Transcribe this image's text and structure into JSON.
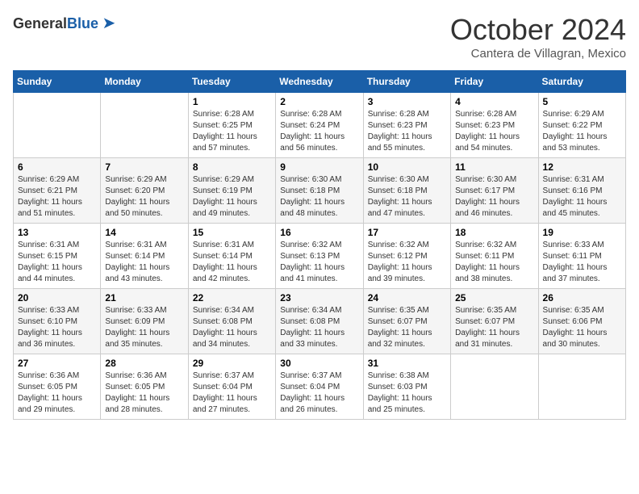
{
  "logo": {
    "general": "General",
    "blue": "Blue"
  },
  "title": "October 2024",
  "location": "Cantera de Villagran, Mexico",
  "weekdays": [
    "Sunday",
    "Monday",
    "Tuesday",
    "Wednesday",
    "Thursday",
    "Friday",
    "Saturday"
  ],
  "weeks": [
    [
      null,
      null,
      {
        "day": 1,
        "sunrise": "6:28 AM",
        "sunset": "6:25 PM",
        "daylight": "11 hours and 57 minutes."
      },
      {
        "day": 2,
        "sunrise": "6:28 AM",
        "sunset": "6:24 PM",
        "daylight": "11 hours and 56 minutes."
      },
      {
        "day": 3,
        "sunrise": "6:28 AM",
        "sunset": "6:23 PM",
        "daylight": "11 hours and 55 minutes."
      },
      {
        "day": 4,
        "sunrise": "6:28 AM",
        "sunset": "6:23 PM",
        "daylight": "11 hours and 54 minutes."
      },
      {
        "day": 5,
        "sunrise": "6:29 AM",
        "sunset": "6:22 PM",
        "daylight": "11 hours and 53 minutes."
      }
    ],
    [
      {
        "day": 6,
        "sunrise": "6:29 AM",
        "sunset": "6:21 PM",
        "daylight": "11 hours and 51 minutes."
      },
      {
        "day": 7,
        "sunrise": "6:29 AM",
        "sunset": "6:20 PM",
        "daylight": "11 hours and 50 minutes."
      },
      {
        "day": 8,
        "sunrise": "6:29 AM",
        "sunset": "6:19 PM",
        "daylight": "11 hours and 49 minutes."
      },
      {
        "day": 9,
        "sunrise": "6:30 AM",
        "sunset": "6:18 PM",
        "daylight": "11 hours and 48 minutes."
      },
      {
        "day": 10,
        "sunrise": "6:30 AM",
        "sunset": "6:18 PM",
        "daylight": "11 hours and 47 minutes."
      },
      {
        "day": 11,
        "sunrise": "6:30 AM",
        "sunset": "6:17 PM",
        "daylight": "11 hours and 46 minutes."
      },
      {
        "day": 12,
        "sunrise": "6:31 AM",
        "sunset": "6:16 PM",
        "daylight": "11 hours and 45 minutes."
      }
    ],
    [
      {
        "day": 13,
        "sunrise": "6:31 AM",
        "sunset": "6:15 PM",
        "daylight": "11 hours and 44 minutes."
      },
      {
        "day": 14,
        "sunrise": "6:31 AM",
        "sunset": "6:14 PM",
        "daylight": "11 hours and 43 minutes."
      },
      {
        "day": 15,
        "sunrise": "6:31 AM",
        "sunset": "6:14 PM",
        "daylight": "11 hours and 42 minutes."
      },
      {
        "day": 16,
        "sunrise": "6:32 AM",
        "sunset": "6:13 PM",
        "daylight": "11 hours and 41 minutes."
      },
      {
        "day": 17,
        "sunrise": "6:32 AM",
        "sunset": "6:12 PM",
        "daylight": "11 hours and 39 minutes."
      },
      {
        "day": 18,
        "sunrise": "6:32 AM",
        "sunset": "6:11 PM",
        "daylight": "11 hours and 38 minutes."
      },
      {
        "day": 19,
        "sunrise": "6:33 AM",
        "sunset": "6:11 PM",
        "daylight": "11 hours and 37 minutes."
      }
    ],
    [
      {
        "day": 20,
        "sunrise": "6:33 AM",
        "sunset": "6:10 PM",
        "daylight": "11 hours and 36 minutes."
      },
      {
        "day": 21,
        "sunrise": "6:33 AM",
        "sunset": "6:09 PM",
        "daylight": "11 hours and 35 minutes."
      },
      {
        "day": 22,
        "sunrise": "6:34 AM",
        "sunset": "6:08 PM",
        "daylight": "11 hours and 34 minutes."
      },
      {
        "day": 23,
        "sunrise": "6:34 AM",
        "sunset": "6:08 PM",
        "daylight": "11 hours and 33 minutes."
      },
      {
        "day": 24,
        "sunrise": "6:35 AM",
        "sunset": "6:07 PM",
        "daylight": "11 hours and 32 minutes."
      },
      {
        "day": 25,
        "sunrise": "6:35 AM",
        "sunset": "6:07 PM",
        "daylight": "11 hours and 31 minutes."
      },
      {
        "day": 26,
        "sunrise": "6:35 AM",
        "sunset": "6:06 PM",
        "daylight": "11 hours and 30 minutes."
      }
    ],
    [
      {
        "day": 27,
        "sunrise": "6:36 AM",
        "sunset": "6:05 PM",
        "daylight": "11 hours and 29 minutes."
      },
      {
        "day": 28,
        "sunrise": "6:36 AM",
        "sunset": "6:05 PM",
        "daylight": "11 hours and 28 minutes."
      },
      {
        "day": 29,
        "sunrise": "6:37 AM",
        "sunset": "6:04 PM",
        "daylight": "11 hours and 27 minutes."
      },
      {
        "day": 30,
        "sunrise": "6:37 AM",
        "sunset": "6:04 PM",
        "daylight": "11 hours and 26 minutes."
      },
      {
        "day": 31,
        "sunrise": "6:38 AM",
        "sunset": "6:03 PM",
        "daylight": "11 hours and 25 minutes."
      },
      null,
      null
    ]
  ]
}
